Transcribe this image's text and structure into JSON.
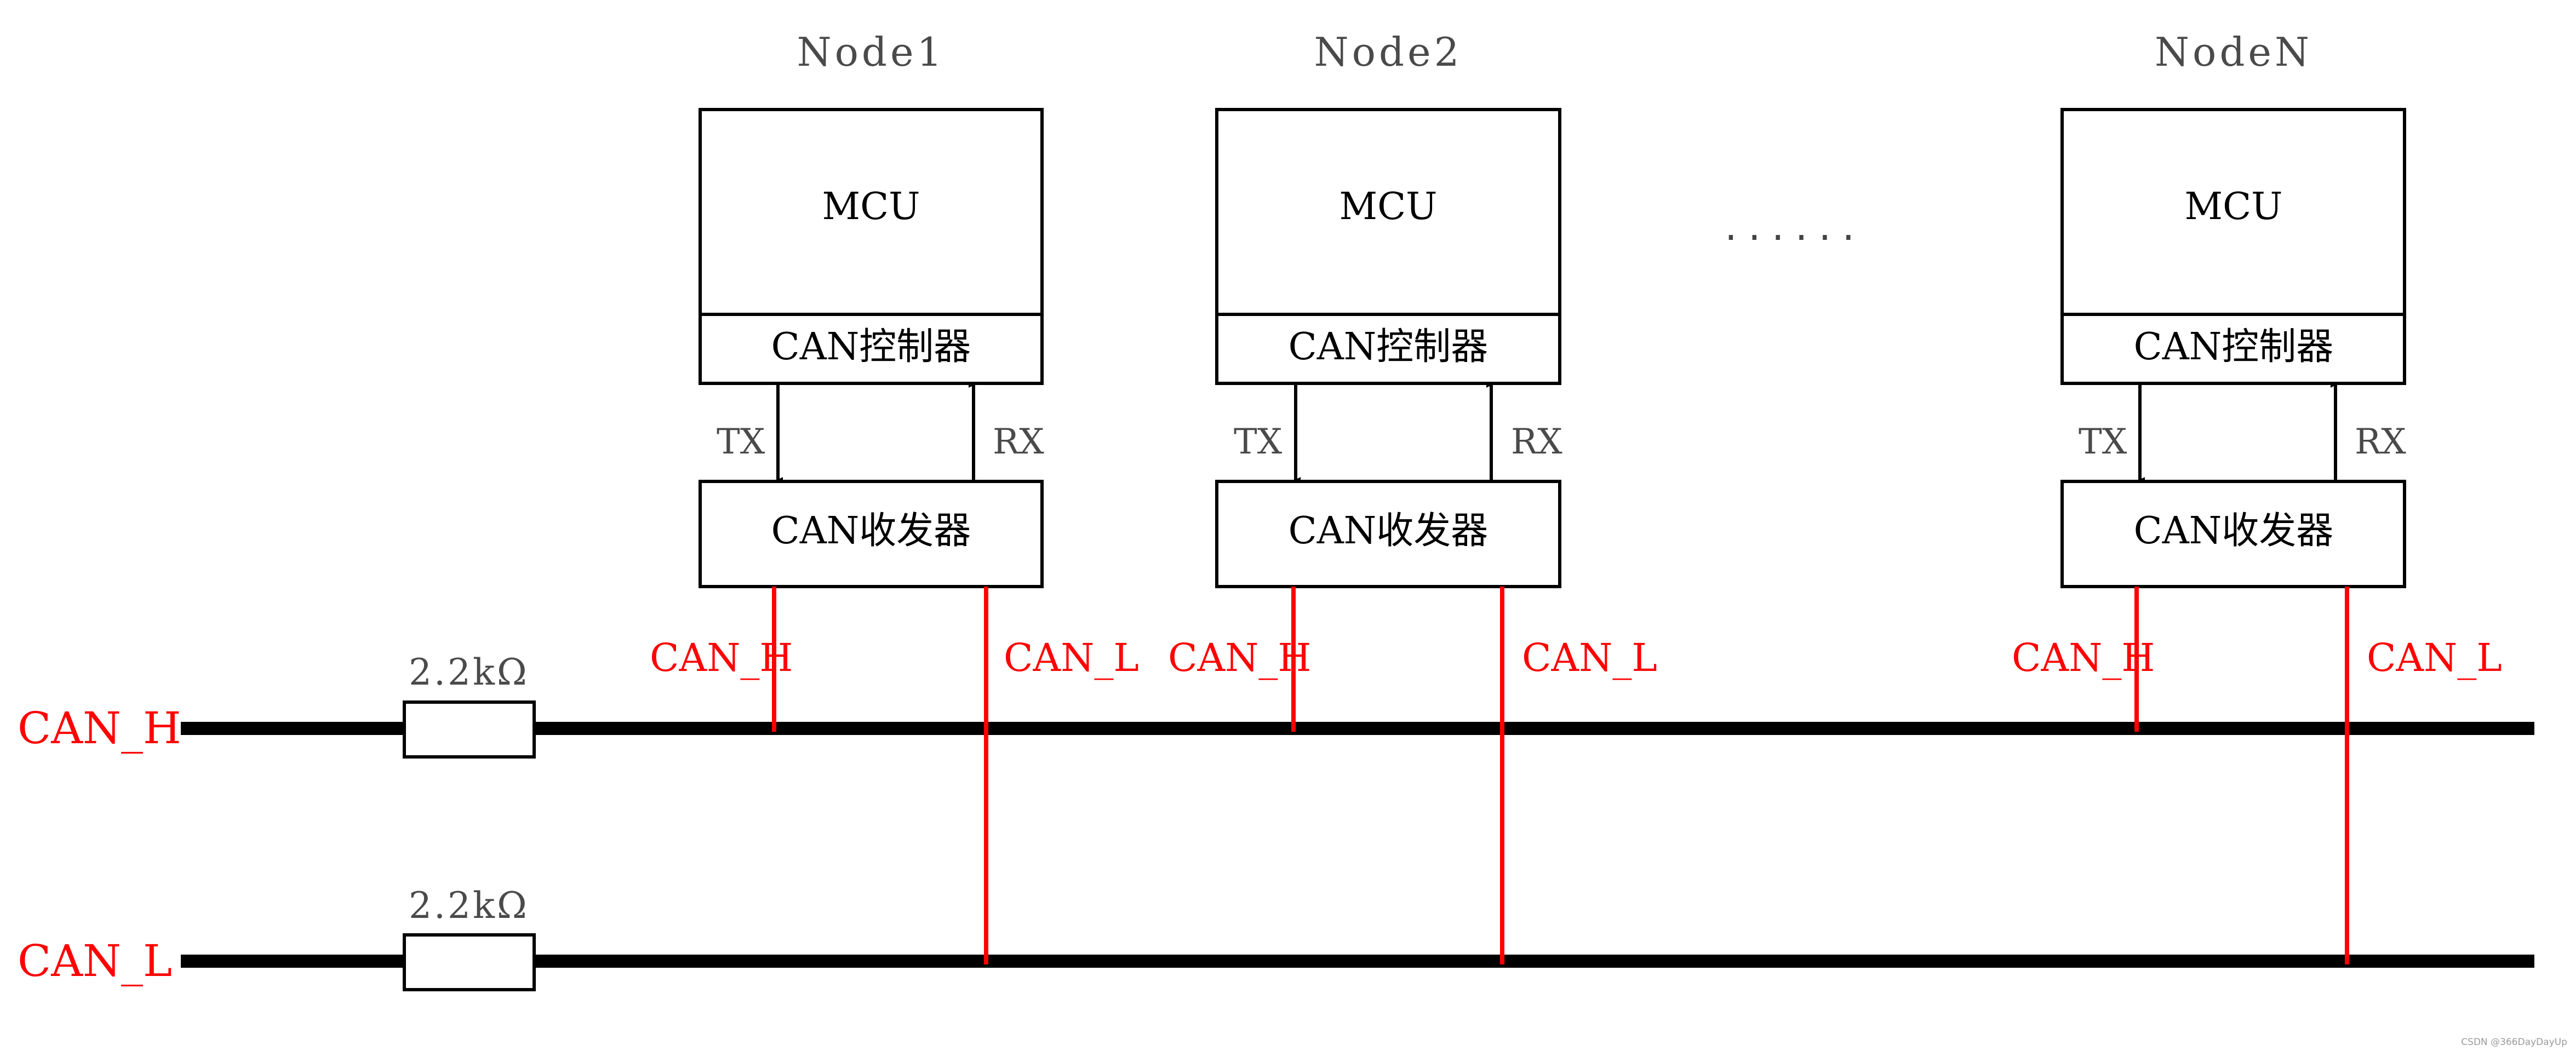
{
  "diagram": {
    "type": "CAN bus topology",
    "colors": {
      "line": "#000000",
      "signal": "#ff0000",
      "muted_text": "#4a4a4a",
      "background": "#ffffff"
    },
    "nodes": [
      {
        "title": "Node1",
        "mcu_label": "MCU",
        "controller_label": "CAN控制器",
        "transceiver_label": "CAN收发器",
        "tx_label": "TX",
        "rx_label": "RX",
        "can_h_label": "CAN_H",
        "can_l_label": "CAN_L"
      },
      {
        "title": "Node2",
        "mcu_label": "MCU",
        "controller_label": "CAN控制器",
        "transceiver_label": "CAN收发器",
        "tx_label": "TX",
        "rx_label": "RX",
        "can_h_label": "CAN_H",
        "can_l_label": "CAN_L"
      },
      {
        "title": "NodeN",
        "mcu_label": "MCU",
        "controller_label": "CAN控制器",
        "transceiver_label": "CAN收发器",
        "tx_label": "TX",
        "rx_label": "RX",
        "can_h_label": "CAN_H",
        "can_l_label": "CAN_L"
      }
    ],
    "ellipsis": "......",
    "buses": [
      {
        "label": "CAN_H",
        "resistor_label": "2.2kΩ"
      },
      {
        "label": "CAN_L",
        "resistor_label": "2.2kΩ"
      }
    ],
    "watermark": "CSDN @366DayDayUp"
  }
}
